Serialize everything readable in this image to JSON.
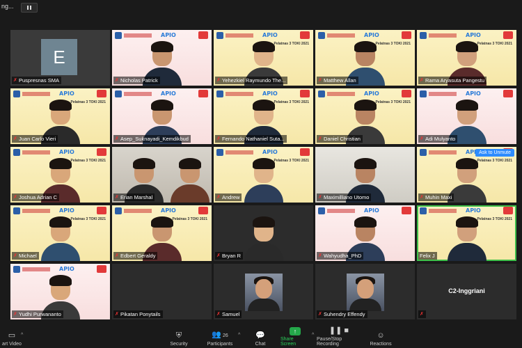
{
  "topbar": {
    "title": "ng...",
    "pause_icon": "pause-icon"
  },
  "tiles": [
    {
      "name": "Puspresnas SMA",
      "muted": true,
      "type": "avatar",
      "avatar_letter": "E"
    },
    {
      "name": "Nicholas Patrick",
      "muted": true,
      "type": "pink"
    },
    {
      "name": "Yehezkiel Raymundo The...",
      "muted": true,
      "type": "yellow"
    },
    {
      "name": "Matthew Allan",
      "muted": true,
      "type": "yellow"
    },
    {
      "name": "Rama Aryasuta Pangestu",
      "muted": true,
      "type": "yellow"
    },
    {
      "name": "Juan Carlo Vieri",
      "muted": true,
      "type": "yellow"
    },
    {
      "name": "Asep_Suknayadi_Kemdikbud",
      "muted": true,
      "type": "pink"
    },
    {
      "name": "Fernando Nathaniel Suta...",
      "muted": true,
      "type": "yellow"
    },
    {
      "name": "Daniel Christian",
      "muted": true,
      "type": "yellow"
    },
    {
      "name": "Adi Mulyanto",
      "muted": true,
      "type": "pink"
    },
    {
      "name": "Joshua Adrian C",
      "muted": true,
      "type": "yellow"
    },
    {
      "name": "Erian Marshal",
      "muted": true,
      "type": "room"
    },
    {
      "name": "Andrew",
      "muted": true,
      "type": "yellow"
    },
    {
      "name": "Maximilliano Utomo",
      "muted": true,
      "type": "shelf"
    },
    {
      "name": "Muhin Maxi",
      "muted": true,
      "type": "yellow",
      "unmute_label": "Ask to Unmute"
    },
    {
      "name": "Michael",
      "muted": true,
      "type": "yellow"
    },
    {
      "name": "Edbert Geraldy",
      "muted": true,
      "type": "yellow"
    },
    {
      "name": "Bryan R",
      "muted": true,
      "type": "gray"
    },
    {
      "name": "Wahyudha_PhD",
      "muted": true,
      "type": "pink"
    },
    {
      "name": "Felix J",
      "muted": false,
      "type": "yellow",
      "active": true
    },
    {
      "name": "Yudhi Purwananto",
      "muted": true,
      "type": "pink"
    },
    {
      "name": "Pikatan Ponytails",
      "muted": true,
      "type": "black"
    },
    {
      "name": "Samuel",
      "muted": true,
      "type": "photo"
    },
    {
      "name": "Suhendry Effendy",
      "muted": true,
      "type": "photo"
    },
    {
      "name": "",
      "muted": true,
      "type": "text",
      "center_text": "C2-Inggriani"
    }
  ],
  "brand": {
    "apio": "APIO",
    "pelatnas": "Pelatnas 3 TOKI 2021"
  },
  "toolbar": {
    "video_label": "art Video",
    "security_label": "Security",
    "participants_label": "Participants",
    "participants_count": "26",
    "chat_label": "Chat",
    "share_label": "Share Screen",
    "record_label": "Pause/Stop Recording",
    "reactions_label": "Reactions"
  },
  "colors": {
    "share_green": "#24a84a",
    "active_border": "#3ec04a",
    "unmute_blue": "#2d8cff",
    "mute_red": "#e33"
  }
}
